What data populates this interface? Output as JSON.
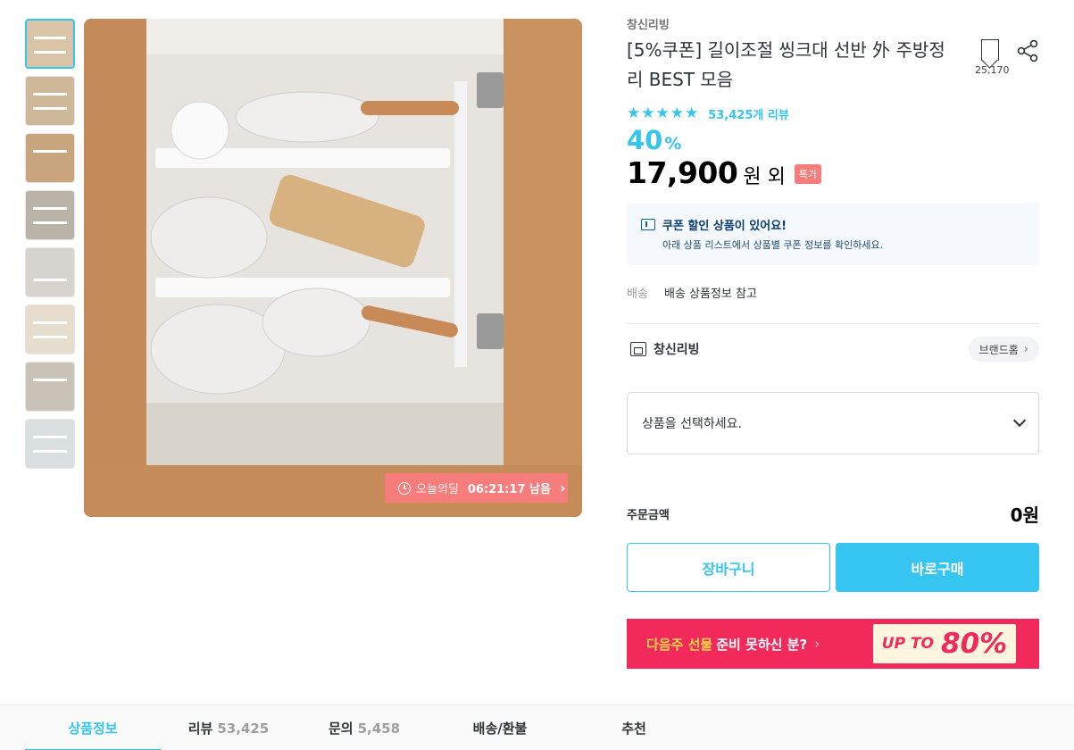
{
  "thumbnails": [
    {
      "label": "thumbnail-1",
      "bg": "#d9c4a8",
      "active": true
    },
    {
      "label": "thumbnail-2",
      "bg": "#cfb89a",
      "active": false
    },
    {
      "label": "thumbnail-3",
      "bg": "#c9a57e",
      "active": false
    },
    {
      "label": "thumbnail-4",
      "bg": "#b9b3a8",
      "active": false
    },
    {
      "label": "thumbnail-5",
      "bg": "#d7d3cf",
      "active": false
    },
    {
      "label": "thumbnail-6",
      "bg": "#e6ddcf",
      "active": false
    },
    {
      "label": "thumbnail-7",
      "bg": "#c8c2b7",
      "active": false
    },
    {
      "label": "thumbnail-8",
      "bg": "#d9dee0",
      "active": false
    }
  ],
  "deal": {
    "label": "오늘의딜",
    "time": "06:21:17 남음"
  },
  "product": {
    "brand": "창신리빙",
    "title": "[5%쿠폰] 길이조절 씽크대 선반 外 주방정리 BEST 모음",
    "bookmark_count": "25,170",
    "rating_stars": "★★★★★",
    "rating_value": 4.5,
    "review_link": "53,425개 리뷰",
    "discount_value": "40",
    "discount_unit": "%",
    "price": "17,900",
    "price_unit": "원 외",
    "special_badge": "특가"
  },
  "coupon": {
    "title": "쿠폰 할인 상품이 있어요!",
    "subtitle": "아래 상품 리스트에서 상품별 쿠폰 정보를 확인하세요."
  },
  "shipping": {
    "label": "배송",
    "value": "배송 상품정보 참고"
  },
  "store": {
    "name": "창신리빙",
    "home_button": "브랜드홈"
  },
  "option_select": {
    "placeholder": "상품을 선택하세요."
  },
  "order": {
    "label": "주문금액",
    "value": "0원"
  },
  "buttons": {
    "cart": "장바구니",
    "buy": "바로구매"
  },
  "banner": {
    "highlight": "다음주 선물",
    "text": "준비 못하신 분?",
    "chevron": "›",
    "badge_prefix": "UP TO",
    "badge_value": "80%"
  },
  "tabs": [
    {
      "label": "상품정보",
      "count": "",
      "active": true
    },
    {
      "label": "리뷰",
      "count": "53,425",
      "active": false
    },
    {
      "label": "문의",
      "count": "5,458",
      "active": false
    },
    {
      "label": "배송/환불",
      "count": "",
      "active": false
    },
    {
      "label": "추천",
      "count": "",
      "active": false
    }
  ],
  "colors": {
    "accent": "#35c5f0",
    "deal": "#f77c7c",
    "banner": "#f2295b"
  }
}
